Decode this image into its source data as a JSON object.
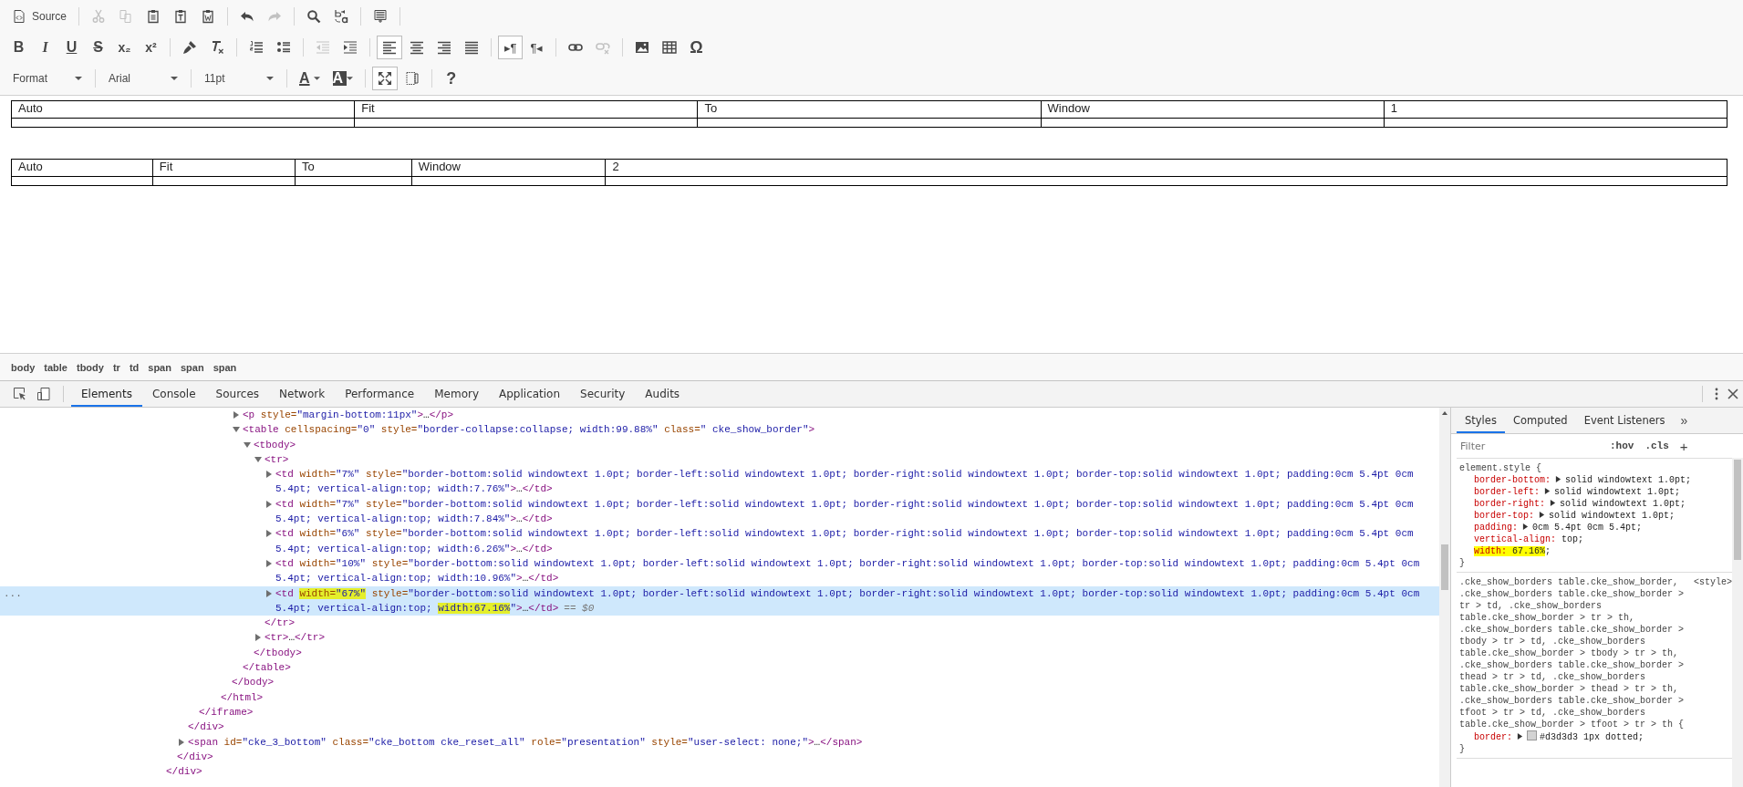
{
  "toolbar": {
    "rows": [
      {
        "groups": [
          {
            "items": [
              {
                "kind": "button",
                "label": "Source",
                "disabled": false,
                "on": false
              }
            ]
          },
          {
            "items": [
              {
                "kind": "button",
                "disabled": true,
                "on": false
              },
              {
                "kind": "button",
                "disabled": true,
                "on": false
              },
              {
                "kind": "button",
                "disabled": false,
                "on": false
              },
              {
                "kind": "button",
                "disabled": false,
                "on": false
              },
              {
                "kind": "button",
                "disabled": false,
                "on": false
              }
            ]
          },
          {
            "items": [
              {
                "kind": "button",
                "disabled": false,
                "on": false
              },
              {
                "kind": "button",
                "disabled": true,
                "on": false
              }
            ]
          },
          {
            "items": [
              {
                "kind": "button",
                "disabled": false,
                "on": false
              },
              {
                "kind": "button",
                "disabled": false,
                "on": false
              }
            ]
          },
          {
            "items": [
              {
                "kind": "button",
                "disabled": false,
                "on": false
              }
            ]
          }
        ]
      },
      {
        "groups": [
          {
            "items": [
              {
                "kind": "glyph",
                "text": "B",
                "disabled": false,
                "on": false
              },
              {
                "kind": "glyph",
                "text": "I",
                "disabled": false,
                "on": false
              },
              {
                "kind": "glyph",
                "text": "U",
                "disabled": false,
                "on": false
              },
              {
                "kind": "glyph",
                "text": "S",
                "disabled": false,
                "on": false
              },
              {
                "kind": "glyph",
                "text": "x₂",
                "disabled": false,
                "on": false
              },
              {
                "kind": "glyph",
                "text": "x²",
                "disabled": false,
                "on": false
              }
            ]
          },
          {
            "items": [
              {
                "kind": "button",
                "disabled": false,
                "on": false
              },
              {
                "kind": "button",
                "disabled": false,
                "on": false
              }
            ]
          },
          {
            "items": [
              {
                "kind": "button",
                "disabled": false,
                "on": false
              },
              {
                "kind": "button",
                "disabled": false,
                "on": false
              }
            ]
          },
          {
            "items": [
              {
                "kind": "button",
                "disabled": true,
                "on": false
              },
              {
                "kind": "button",
                "disabled": false,
                "on": false
              }
            ]
          },
          {
            "items": [
              {
                "kind": "button",
                "disabled": false,
                "on": true
              },
              {
                "kind": "button",
                "disabled": false,
                "on": false
              },
              {
                "kind": "button",
                "disabled": false,
                "on": false
              },
              {
                "kind": "button",
                "disabled": false,
                "on": false
              }
            ]
          },
          {
            "items": [
              {
                "kind": "glyph",
                "text": "▸¶",
                "disabled": false,
                "on": true
              },
              {
                "kind": "glyph",
                "text": "¶◂",
                "disabled": false,
                "on": false
              }
            ]
          },
          {
            "items": [
              {
                "kind": "button",
                "disabled": false,
                "on": false
              },
              {
                "kind": "button",
                "disabled": true,
                "on": false
              }
            ]
          },
          {
            "items": [
              {
                "kind": "button",
                "disabled": false,
                "on": false
              },
              {
                "kind": "button",
                "disabled": false,
                "on": false
              },
              {
                "kind": "glyph",
                "text": "Ω",
                "disabled": false,
                "on": false
              }
            ]
          }
        ]
      },
      {
        "groups": [
          {
            "items": [
              {
                "kind": "combo",
                "value": "Format"
              }
            ]
          },
          {
            "items": [
              {
                "kind": "combo",
                "value": "Arial"
              }
            ]
          },
          {
            "items": [
              {
                "kind": "combo",
                "value": "11pt"
              }
            ]
          },
          {
            "items": [
              {
                "kind": "glyph",
                "text": "A",
                "disabled": false,
                "on": false
              },
              {
                "kind": "glyph",
                "text": "A",
                "disabled": false,
                "on": false
              }
            ]
          },
          {
            "items": [
              {
                "kind": "button",
                "disabled": false,
                "on": true
              },
              {
                "kind": "button",
                "disabled": false,
                "on": false
              }
            ]
          },
          {
            "items": [
              {
                "kind": "glyph",
                "text": "?",
                "disabled": false,
                "on": false
              }
            ]
          }
        ]
      }
    ]
  },
  "document": {
    "tables": [
      {
        "rows": [
          {
            "cells": [
              "Auto",
              "Fit",
              "To",
              "Window",
              "1"
            ]
          },
          {
            "cells": [
              null,
              null,
              null,
              null,
              null
            ]
          }
        ]
      },
      {
        "rows": [
          {
            "cells": [
              "Auto",
              "Fit",
              "To",
              "Window",
              "2"
            ]
          },
          {
            "cells": [
              null,
              null,
              null,
              null,
              null
            ]
          }
        ]
      }
    ]
  },
  "path_bar": {
    "items": [
      "body",
      "table",
      "tbody",
      "tr",
      "td",
      "span",
      "span",
      "span"
    ]
  },
  "devtools": {
    "tabs": [
      {
        "label": "Elements",
        "selected": true
      },
      {
        "label": "Console",
        "selected": false
      },
      {
        "label": "Sources",
        "selected": false
      },
      {
        "label": "Network",
        "selected": false
      },
      {
        "label": "Performance",
        "selected": false
      },
      {
        "label": "Memory",
        "selected": false
      },
      {
        "label": "Application",
        "selected": false
      },
      {
        "label": "Security",
        "selected": false
      },
      {
        "label": "Audits",
        "selected": false
      }
    ]
  },
  "elements": {
    "nodes": [
      {
        "close": "</div>",
        "children": [
          {
            "close": "</div>",
            "children": [
              {
                "close": "</div>",
                "children": [
                  {
                    "close": "</iframe>",
                    "children": [
                      {
                        "children": [
                          {
                            "close": "</html>",
                            "children": [
                              {
                                "close": "</body>",
                                "children": [
                                  {
                                    "parts": [
                                      {
                                        "text": "<p style=\"margin-bottom:11px\">…</p>",
                                        "highlighted": false
                                      }
                                    ],
                                    "expanded": false,
                                    "selected": false
                                  },
                                  {
                                    "parts": [
                                      {
                                        "text": "<table cellspacing=\"0\" style=\"border-collapse:collapse; width:99.88%\" class=\" cke_show_border\">",
                                        "highlighted": false
                                      }
                                    ],
                                    "expanded": true,
                                    "selected": false,
                                    "close": "</table>",
                                    "children": [
                                      {
                                        "parts": [
                                          {
                                            "text": "<tbody>",
                                            "highlighted": false
                                          }
                                        ],
                                        "expanded": true,
                                        "selected": false,
                                        "close": "</tbody>",
                                        "children": [
                                          {
                                            "parts": [
                                              {
                                                "text": "<tr>",
                                                "highlighted": false
                                              }
                                            ],
                                            "expanded": true,
                                            "selected": false,
                                            "close": "</tr>",
                                            "children": [
                                              {
                                                "parts": [
                                                  {
                                                    "text": "<td width=\"7%\" style=\"border-bottom:solid windowtext 1.0pt; border-left:solid windowtext 1.0pt; border-right:solid windowtext 1.0pt; border-top:solid windowtext 1.0pt; padding:0cm 5.4pt 0cm 5.4pt; vertical-align:top; width:7.76%\">…</td>",
                                                    "highlighted": false
                                                  }
                                                ],
                                                "expanded": false,
                                                "selected": false
                                              },
                                              {
                                                "parts": [
                                                  {
                                                    "text": "<td width=\"7%\" style=\"border-bottom:solid windowtext 1.0pt; border-left:solid windowtext 1.0pt; border-right:solid windowtext 1.0pt; border-top:solid windowtext 1.0pt; padding:0cm 5.4pt 0cm 5.4pt; vertical-align:top; width:7.84%\">…</td>",
                                                    "highlighted": false
                                                  }
                                                ],
                                                "expanded": false,
                                                "selected": false
                                              },
                                              {
                                                "parts": [
                                                  {
                                                    "text": "<td width=\"6%\" style=\"border-bottom:solid windowtext 1.0pt; border-left:solid windowtext 1.0pt; border-right:solid windowtext 1.0pt; border-top:solid windowtext 1.0pt; padding:0cm 5.4pt 0cm 5.4pt; vertical-align:top; width:6.26%\">…</td>",
                                                    "highlighted": false
                                                  }
                                                ],
                                                "expanded": false,
                                                "selected": false
                                              },
                                              {
                                                "parts": [
                                                  {
                                                    "text": "<td width=\"10%\" style=\"border-bottom:solid windowtext 1.0pt; border-left:solid windowtext 1.0pt; border-right:solid windowtext 1.0pt; border-top:solid windowtext 1.0pt; padding:0cm 5.4pt 0cm 5.4pt; vertical-align:top; width:10.96%\">…</td>",
                                                    "highlighted": false
                                                  }
                                                ],
                                                "expanded": false,
                                                "selected": false
                                              },
                                              {
                                                "parts": [
                                                  {
                                                    "text": "<td ",
                                                    "highlighted": false
                                                  },
                                                  {
                                                    "text": "width=\"67%\"",
                                                    "highlighted": true
                                                  },
                                                  {
                                                    "text": " style=\"border-bottom:solid windowtext 1.0pt; border-left:solid windowtext 1.0pt; border-right:solid windowtext 1.0pt; border-top:solid windowtext 1.0pt; padding:0cm 5.4pt 0cm 5.4pt; vertical-align:top; ",
                                                    "highlighted": false
                                                  },
                                                  {
                                                    "text": "width:67.16%",
                                                    "highlighted": true
                                                  },
                                                  {
                                                    "text": "\">…</td>",
                                                    "highlighted": false
                                                  }
                                                ],
                                                "expanded": false,
                                                "selected": true,
                                                "gutter": "...",
                                                "note": "== $0"
                                              }
                                            ]
                                          },
                                          {
                                            "parts": [
                                              {
                                                "text": "<tr>…</tr>",
                                                "highlighted": false
                                              }
                                            ],
                                            "expanded": false,
                                            "selected": false
                                          }
                                        ]
                                      }
                                    ]
                                  }
                                ]
                              }
                            ]
                          }
                        ]
                      }
                    ]
                  }
                ]
              },
              {
                "parts": [
                  {
                    "text": "<span id=\"cke_3_bottom\" class=\"cke_bottom cke_reset_all\" role=\"presentation\" style=\"user-select: none;\">…</span>",
                    "highlighted": false
                  }
                ],
                "expanded": false,
                "selected": false
              }
            ]
          }
        ]
      }
    ]
  },
  "styles": {
    "tabs": [
      {
        "label": "Styles",
        "selected": true
      },
      {
        "label": "Computed",
        "selected": false
      },
      {
        "label": "Event Listeners",
        "selected": false
      }
    ],
    "more": "»",
    "filter": {
      "placeholder": "Filter"
    },
    "hov": ":hov",
    "cls": ".cls",
    "add": "+",
    "rules": [
      {
        "selector": "element.style {",
        "properties": [
          {
            "name": "border-bottom:",
            "value": "solid windowtext 1.0pt",
            "end": ";",
            "expandable": true,
            "highlighted": false
          },
          {
            "name": "border-left:",
            "value": "solid windowtext 1.0pt",
            "end": ";",
            "expandable": true,
            "highlighted": false
          },
          {
            "name": "border-right:",
            "value": "solid windowtext 1.0pt",
            "end": ";",
            "expandable": true,
            "highlighted": false
          },
          {
            "name": "border-top:",
            "value": "solid windowtext 1.0pt",
            "end": ";",
            "expandable": true,
            "highlighted": false
          },
          {
            "name": "padding:",
            "value": "0cm 5.4pt 0cm 5.4pt",
            "end": ";",
            "expandable": true,
            "highlighted": false
          },
          {
            "name": "vertical-align:",
            "value": "top",
            "end": ";",
            "expandable": false,
            "highlighted": false
          },
          {
            "name": "width:",
            "value": "67.16%",
            "end": ";",
            "expandable": false,
            "highlighted": true
          }
        ],
        "close": "}"
      },
      {
        "selector": ".cke_show_borders table.cke_show_border, .cke_show_borders table.cke_show_border > tr > td, .cke_show_borders table.cke_show_border > tr > th, .cke_show_borders table.cke_show_border > tbody > tr > td, .cke_show_borders table.cke_show_border > tbody > tr > th, .cke_show_borders table.cke_show_border > thead > tr > td, .cke_show_borders table.cke_show_border > thead > tr > th, .cke_show_borders table.cke_show_border > tfoot > tr > td, .cke_show_borders table.cke_show_border > tfoot > tr > th {",
        "source": "<style>",
        "properties": [
          {
            "name": "border:",
            "value": "#d3d3d3 1px dotted",
            "end": ";",
            "expandable": true,
            "highlighted": false,
            "color": "#d3d3d3"
          }
        ],
        "close": "}"
      }
    ]
  }
}
